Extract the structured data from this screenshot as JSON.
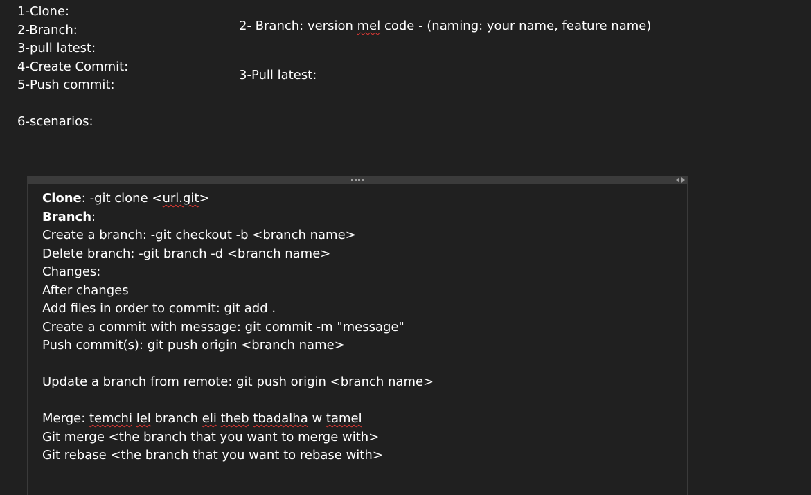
{
  "steps": [
    "1-Clone:",
    "2-Branch:",
    "3-pull latest:",
    "4-Create Commit:",
    "5-Push commit:",
    "6-scenarios:"
  ],
  "notes": {
    "branch_prefix": "2- Branch: version ",
    "branch_word": "mel",
    "branch_suffix": " code  - (naming: your name, feature name)",
    "pull": "3-Pull latest:"
  },
  "panel": {
    "clone_label": "Clone",
    "clone_prefix": ": -git clone <",
    "clone_url": "url.git",
    "clone_suffix": ">",
    "branch_label": "Branch",
    "branch_colon": ":",
    "create_branch": "Create a branch: -git checkout -b <branch name>",
    "delete_branch": "Delete branch: -git branch -d <branch name>",
    "changes": "Changes:",
    "after_changes": "After changes",
    "add_files": "Add files in order to commit:  git add .",
    "create_commit": "Create a commit with message: git commit -m \"message\"",
    "push_commits": "Push commit(s): git push origin <branch name>",
    "update_branch": "Update a branch from remote: git push origin <branch name>",
    "merge_prefix": "Merge: ",
    "merge_w1": "temchi",
    "merge_w2": "lel",
    "merge_mid1": " branch ",
    "merge_w3": "eli",
    "merge_w4": "theb",
    "merge_w5": "tbadalha",
    "merge_mid2": " w ",
    "merge_w6": "tamel",
    "git_merge": "Git merge <the branch that you want to merge with>",
    "git_rebase": "Git rebase <the branch that you want to rebase with>"
  }
}
